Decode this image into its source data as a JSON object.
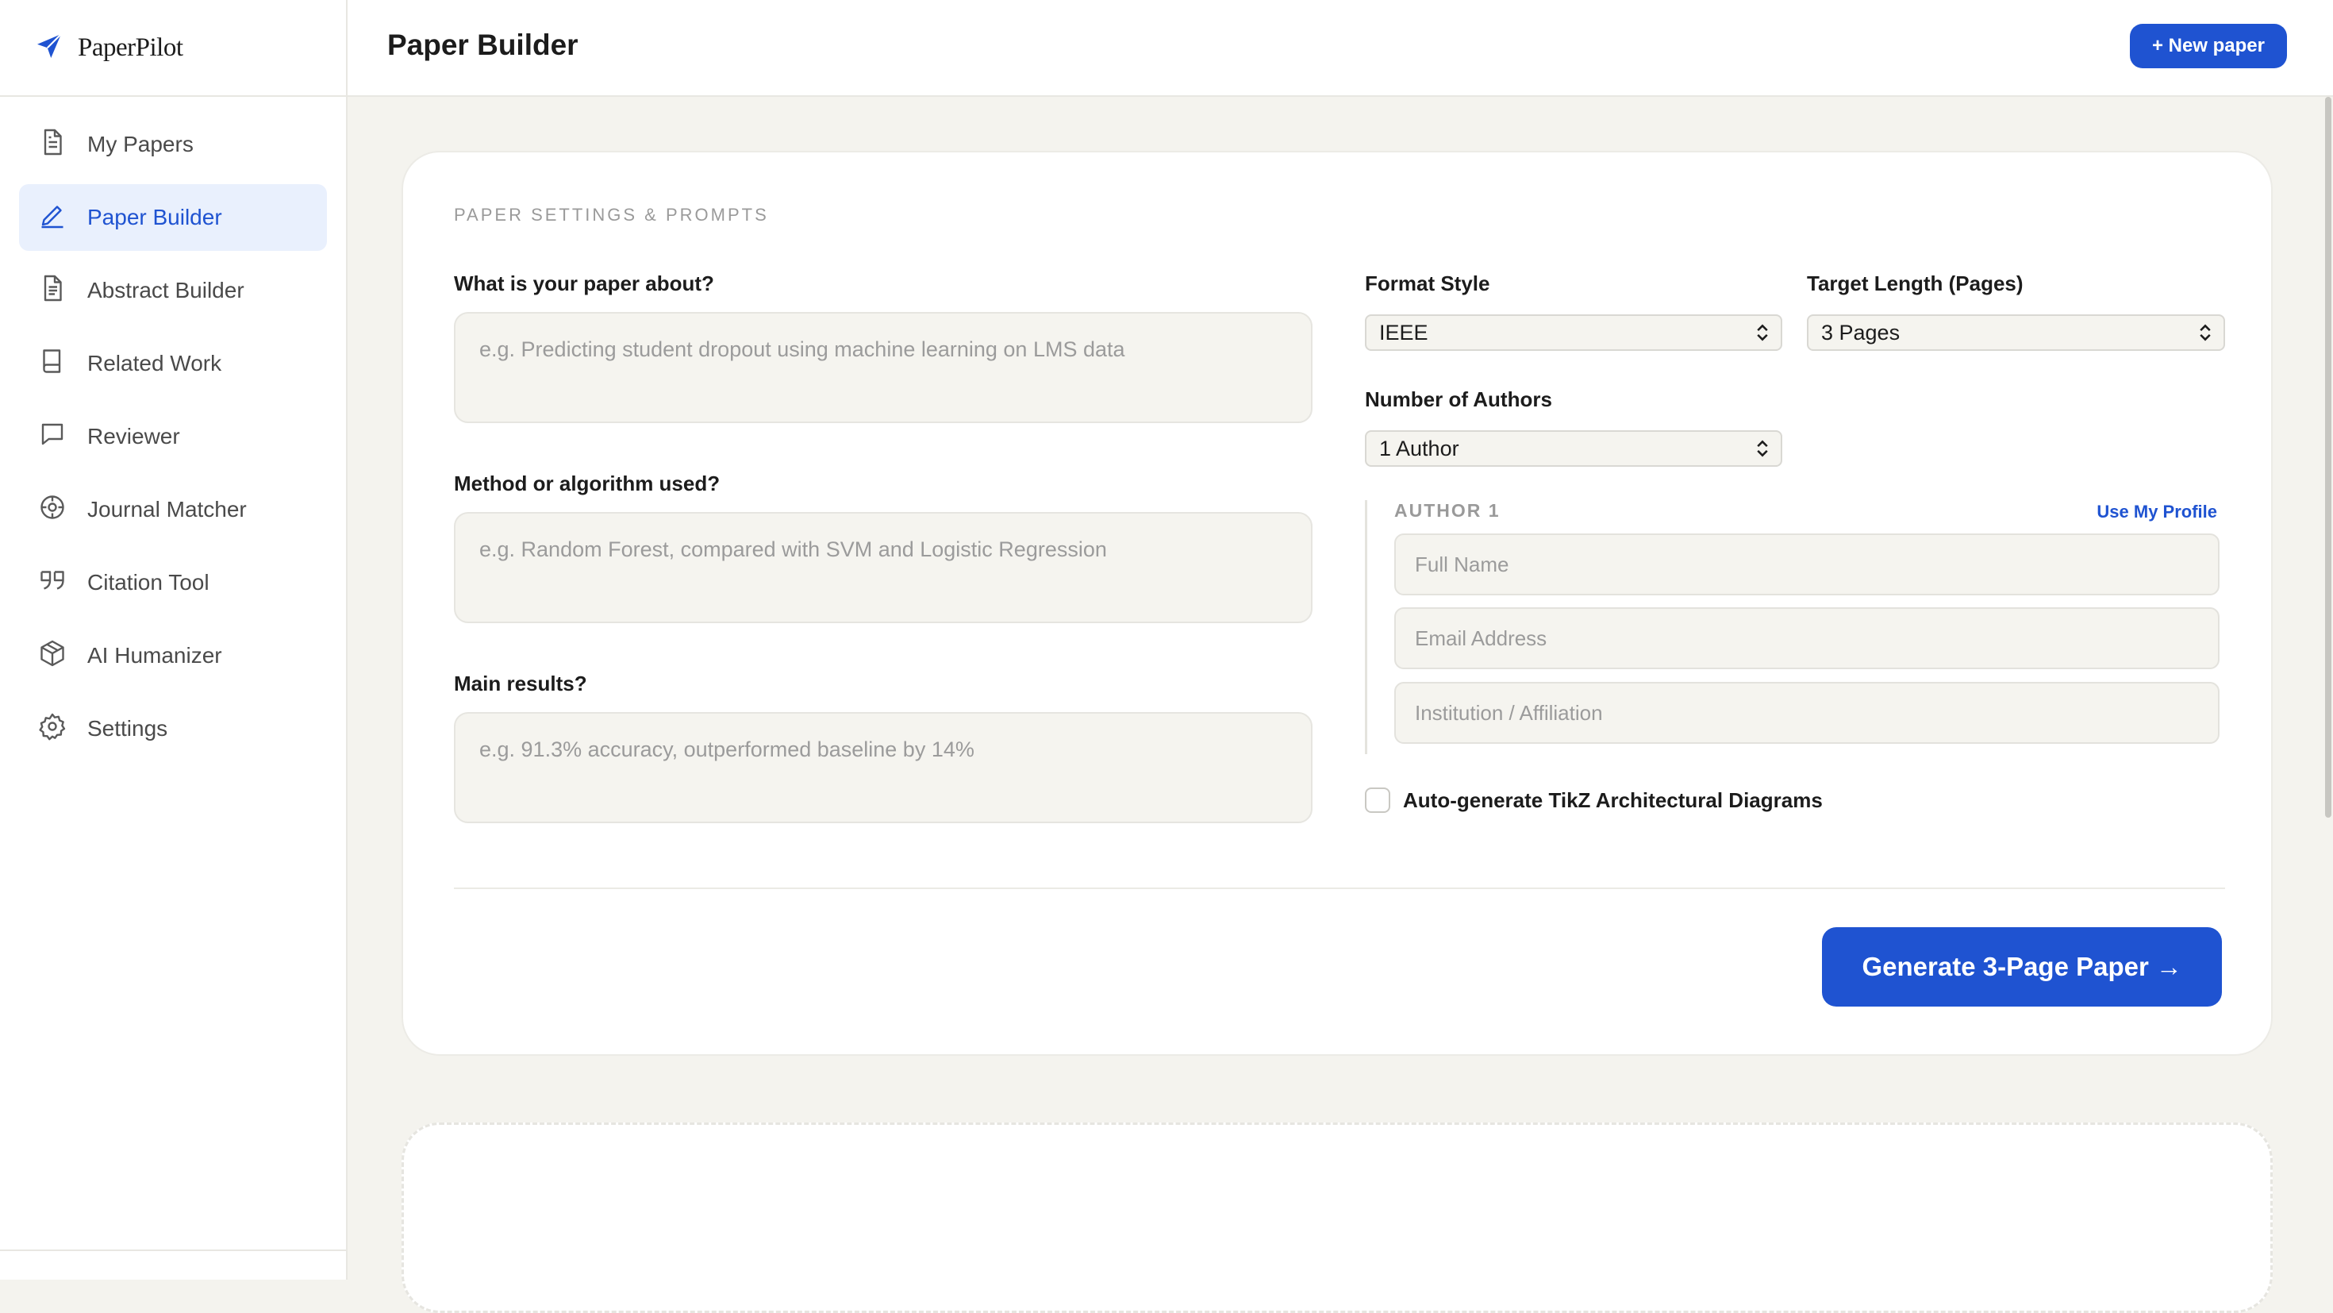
{
  "brand": {
    "name": "PaperPilot"
  },
  "sidebar": {
    "items": [
      {
        "label": "My Papers",
        "icon": "file-text-icon"
      },
      {
        "label": "Paper Builder",
        "icon": "pencil-icon",
        "active": true
      },
      {
        "label": "Abstract Builder",
        "icon": "file-lines-icon"
      },
      {
        "label": "Related Work",
        "icon": "book-icon"
      },
      {
        "label": "Reviewer",
        "icon": "message-square-icon"
      },
      {
        "label": "Journal Matcher",
        "icon": "target-icon"
      },
      {
        "label": "Citation Tool",
        "icon": "quote-icon"
      },
      {
        "label": "AI Humanizer",
        "icon": "cube-icon"
      },
      {
        "label": "Settings",
        "icon": "gear-icon"
      }
    ]
  },
  "header": {
    "title": "Paper Builder",
    "new_paper_label": "+ New paper"
  },
  "form": {
    "section_label": "PAPER SETTINGS & PROMPTS",
    "about_label": "What is your paper about?",
    "about_placeholder": "e.g. Predicting student dropout using machine learning on LMS data",
    "method_label": "Method or algorithm used?",
    "method_placeholder": "e.g. Random Forest, compared with SVM and Logistic Regression",
    "results_label": "Main results?",
    "results_placeholder": "e.g. 91.3% accuracy, outperformed baseline by 14%",
    "format_label": "Format Style",
    "format_value": "IEEE",
    "length_label": "Target Length (Pages)",
    "length_value": "3 Pages",
    "authors_label": "Number of Authors",
    "authors_value": "1 Author",
    "author1": {
      "title": "AUTHOR 1",
      "use_profile": "Use My Profile",
      "name_placeholder": "Full Name",
      "email_placeholder": "Email Address",
      "institution_placeholder": "Institution / Affiliation"
    },
    "tikz_label": "Auto-generate TikZ Architectural Diagrams",
    "tikz_checked": false,
    "generate_label": "Generate 3-Page Paper →"
  },
  "colors": {
    "accent": "#1f53d1",
    "active_bg": "#e9f0fd",
    "page_bg": "#f4f3ee"
  }
}
